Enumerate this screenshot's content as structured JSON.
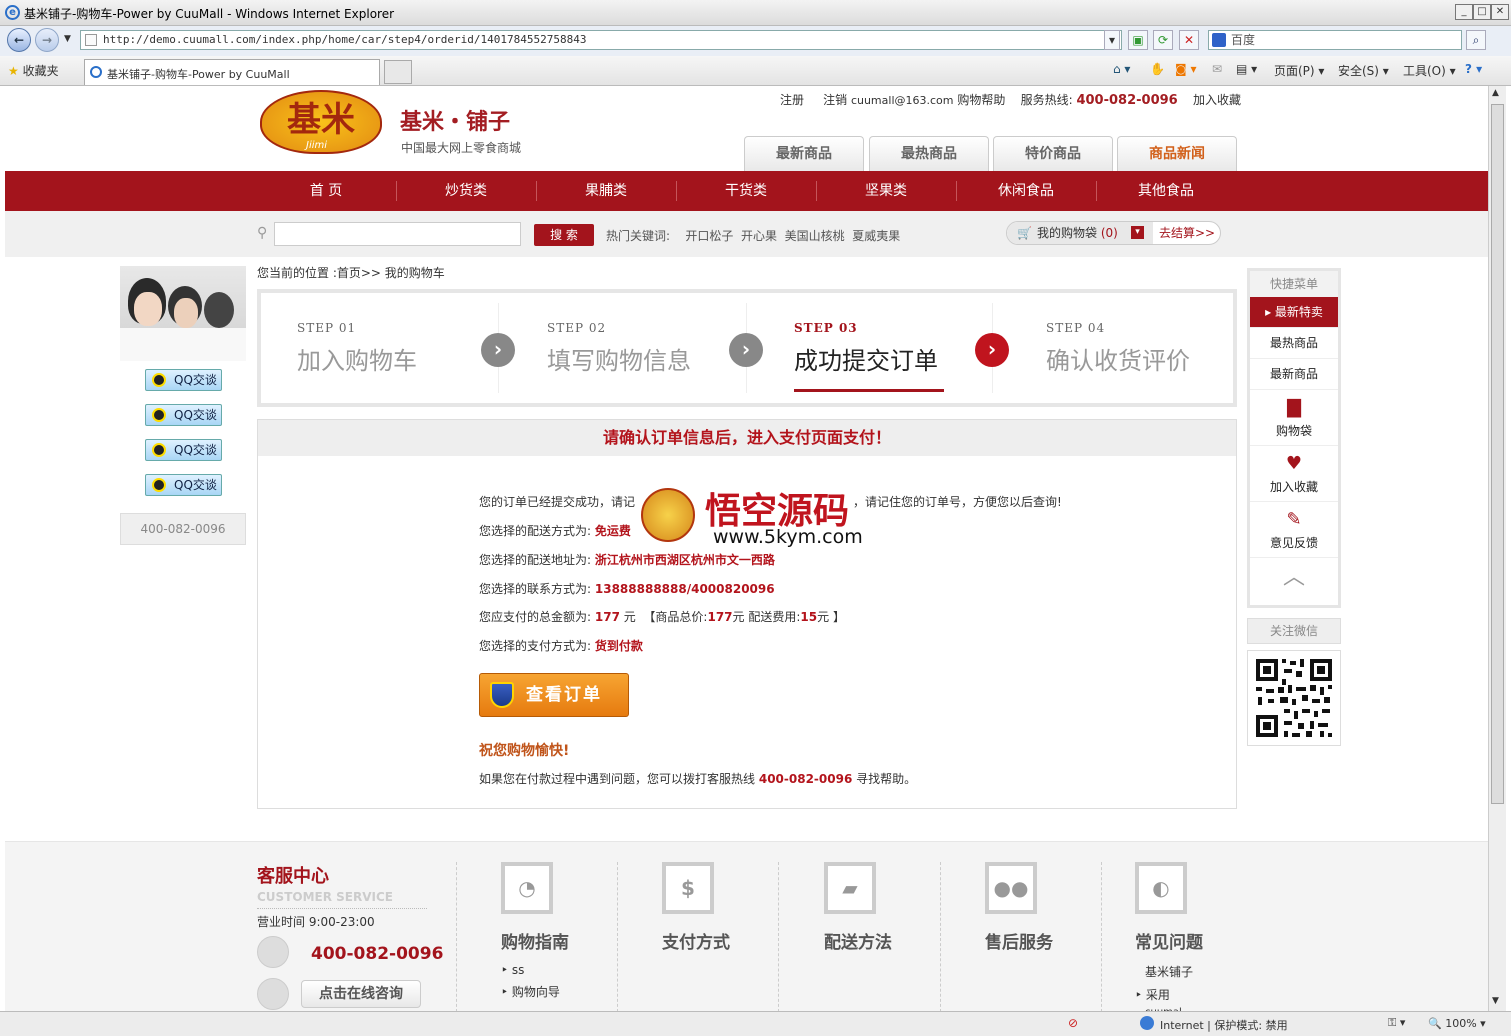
{
  "window": {
    "title": "基米铺子-购物车-Power by CuuMall - Windows Internet Explorer",
    "url": "http://demo.cuumall.com/index.php/home/car/step4/orderid/1401784552758843",
    "search_placeholder": "百度",
    "favorites": "收藏夹",
    "tab_title": "基米铺子-购物车-Power by CuuMall",
    "cmd_page": "页面(P)",
    "cmd_safety": "安全(S)",
    "cmd_tools": "工具(O)",
    "status_zone": "Internet | 保护模式: 禁用",
    "zoom": "100%"
  },
  "header": {
    "logo_text": "基米",
    "logo_sub": "Jiimi",
    "brand": "基米・铺子",
    "tagline": "中国最大网上零食商城",
    "links": {
      "register": "注册",
      "logout": "注销",
      "email": "cuumall@163.com",
      "help": "购物帮助",
      "hotline_label": "服务热线:",
      "hotline": "400-082-0096",
      "favorite": "加入收藏"
    },
    "tabs": [
      "最新商品",
      "最热商品",
      "特价商品",
      "商品新闻"
    ]
  },
  "nav": [
    "首 页",
    "炒货类",
    "果脯类",
    "干货类",
    "坚果类",
    "休闲食品",
    "其他食品"
  ],
  "search": {
    "button": "搜 索",
    "hot_label": "热门关键词:",
    "hot_words": [
      "开口松子",
      "开心果",
      "美国山核桃",
      "夏威夷果"
    ],
    "cart_label": "我的购物袋",
    "cart_count": "(0)",
    "checkout": "去结算>>"
  },
  "service": {
    "qq": [
      "QQ交谈",
      "QQ交谈",
      "QQ交谈",
      "QQ交谈"
    ],
    "phone": "400-082-0096"
  },
  "breadcrumb": "您当前的位置 :首页>> 我的购物车",
  "steps": [
    {
      "num": "STEP 01",
      "label": "加入购物车"
    },
    {
      "num": "STEP 02",
      "label": "填写购物信息"
    },
    {
      "num": "STEP 03",
      "label": "成功提交订单"
    },
    {
      "num": "STEP 04",
      "label": "确认收货评价"
    }
  ],
  "order": {
    "heading": "请确认订单信息后，进入支付页面支付！",
    "line1_a": "您的订单已经提交成功，请记",
    "line1_b": "，请记住您的订单号，方便您以后查询!",
    "ship_label": "您选择的配送方式为:",
    "ship_value": "免运费",
    "addr_label": "您选择的配送地址为:",
    "addr_value": "浙江杭州市西湖区杭州市文一西路",
    "contact_label": "您选择的联系方式为:",
    "contact_value": "13888888888/4000820096",
    "total_label": "您应支付的总金额为:",
    "total_value": "177",
    "total_unit": "元",
    "goods_label": "【商品总价:",
    "goods_value": "177",
    "goods_unit": "元",
    "fee_label": "配送费用:",
    "fee_value": "15",
    "fee_unit": "元 】",
    "pay_label": "您选择的支付方式为:",
    "pay_value": "货到付款",
    "view_button": "查看订单",
    "happy": "祝您购物愉快!",
    "help_a": "如果您在付款过程中遇到问题，您可以拨打客服热线",
    "help_phone": "400-082-0096",
    "help_b": "寻找帮助。"
  },
  "watermark": {
    "cn": "悟空源码",
    "url": "www.5kym.com"
  },
  "quick": {
    "header": "快捷菜单",
    "items": [
      "最新特卖",
      "最热商品",
      "最新商品"
    ],
    "icons": [
      {
        "icon": "bag-icon",
        "label": "购物袋"
      },
      {
        "icon": "heart-icon",
        "label": "加入收藏"
      },
      {
        "icon": "edit-icon",
        "label": "意见反馈"
      }
    ],
    "wechat": "关注微信"
  },
  "footer": {
    "cs_title": "客服中心",
    "cs_en": "CUSTOMER SERVICE",
    "hours": "营业时间 9:00-23:00",
    "phone": "400-082-0096",
    "consult": "点击在线咨询",
    "cols": [
      {
        "title": "购物指南",
        "icon": "chart-icon",
        "glyph": "◔",
        "links": [
          "ss",
          "购物向导"
        ]
      },
      {
        "title": "支付方式",
        "icon": "dollar-icon",
        "glyph": "$",
        "links": []
      },
      {
        "title": "配送方法",
        "icon": "truck-icon",
        "glyph": "▰",
        "links": []
      },
      {
        "title": "售后服务",
        "icon": "people-icon",
        "glyph": "●●",
        "links": []
      },
      {
        "title": "常见问题",
        "icon": "chat-icon",
        "glyph": "◐",
        "links": [
          "基米铺子",
          "采用",
          "cuumal"
        ]
      }
    ]
  }
}
